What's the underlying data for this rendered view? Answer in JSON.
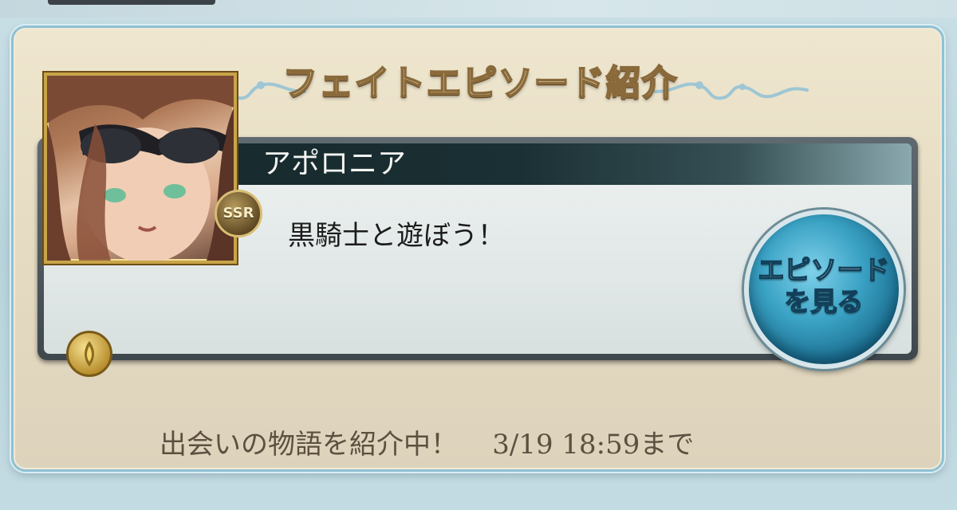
{
  "panel": {
    "title": "フェイトエピソード紹介"
  },
  "card": {
    "character_name": "アポロニア",
    "episode_title": "黒騎士と遊ぼう！",
    "rarity_badge": "SSR",
    "view_button": {
      "line1": "エピソード",
      "line2": "を見る"
    }
  },
  "footer": {
    "message": "出会いの物語を紹介中！",
    "deadline": "3/19 18:59まで"
  },
  "colors": {
    "panel_border": "#8fc1d2",
    "name_bar": "#1b3034",
    "button_blue": "#3aa2c4",
    "title_text": "#fbf3d8",
    "footer_text": "#5e5040"
  },
  "icons": {
    "ornament": "scroll-flourish-icon",
    "element": "wind-element-icon"
  }
}
